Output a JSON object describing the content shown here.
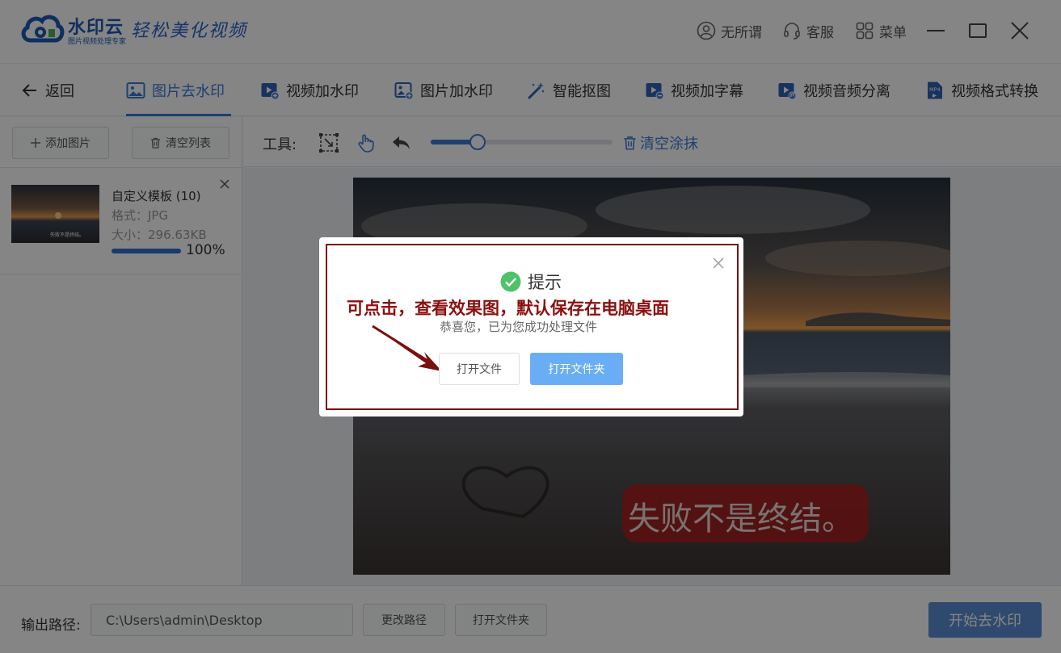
{
  "colors": {
    "accent": "#3b7bd8",
    "annotation": "#8b1010",
    "primary_button": "#69aef5",
    "start_button": "#5b8fd4"
  },
  "titlebar": {
    "brand_name": "水印云",
    "brand_sub": "图片视频处理专家",
    "slogan": "轻松美化视频",
    "user_label": "无所谓",
    "service_label": "客服",
    "menu_label": "菜单",
    "icons": [
      "user-icon",
      "headset-icon",
      "grid-menu-icon",
      "minimize-icon",
      "maximize-icon",
      "close-icon"
    ]
  },
  "nav": {
    "back_label": "返回",
    "items": [
      {
        "label": "图片去水印",
        "icon": "image-icon",
        "active": true
      },
      {
        "label": "视频加水印",
        "icon": "video-plus-icon"
      },
      {
        "label": "图片加水印",
        "icon": "image-plus-icon"
      },
      {
        "label": "智能抠图",
        "icon": "magic-wand-icon"
      },
      {
        "label": "视频加字幕",
        "icon": "video-caption-icon"
      },
      {
        "label": "视频音频分离",
        "icon": "video-audio-icon"
      },
      {
        "label": "视频格式转换",
        "icon": "mp4-file-icon"
      }
    ]
  },
  "leftpanel": {
    "add_label": "添加图片",
    "clear_label": "清空列表",
    "file": {
      "name": "自定义模板 (10)",
      "format": "格式：JPG",
      "size": "大小：296.63KB",
      "progress_pct": "100%",
      "progress_value": 1.0,
      "thumb_text": "失败不是终结。"
    }
  },
  "toolbar": {
    "label": "工具:",
    "brush_value": 0.26,
    "clear_label": "清空涂抹"
  },
  "preview": {
    "caption": "失败不是终结。"
  },
  "bottom": {
    "output_label": "输出路径:",
    "output_path": "C:\\Users\\admin\\Desktop",
    "change_label": "更改路径",
    "open_folder_label": "打开文件夹",
    "start_label": "开始去水印"
  },
  "dialog": {
    "title": "提示",
    "annotation": "可点击，查看效果图，默认保存在电脑桌面",
    "message": "恭喜您，已为您成功处理文件",
    "open_file_label": "打开文件",
    "open_folder_label": "打开文件夹"
  }
}
